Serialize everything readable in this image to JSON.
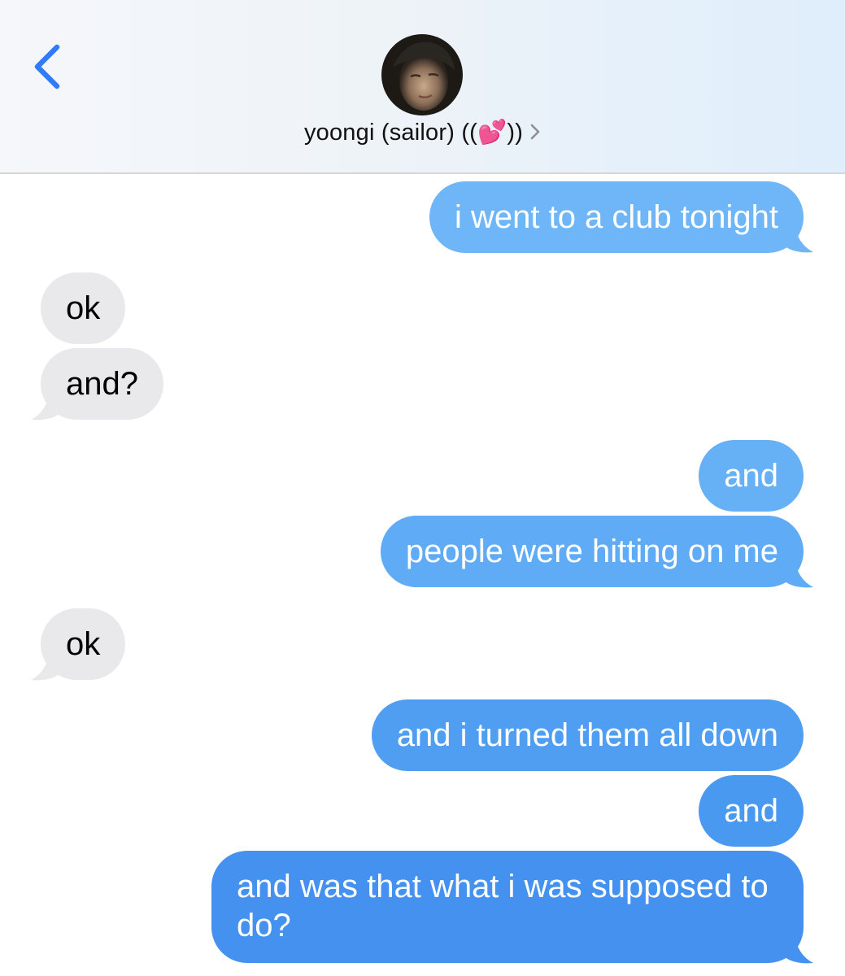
{
  "header": {
    "contact_name": "yoongi (sailor) ((💕))",
    "back_icon": "chevron-left-icon",
    "disclosure_icon": "chevron-right-icon"
  },
  "colors": {
    "sent_top": "#6fb8f7",
    "sent_bottom": "#3a86ee",
    "received": "#e9e9eb",
    "accent": "#2f7cf6"
  },
  "messages": [
    {
      "from": "me",
      "text": "i went to a club tonight"
    },
    {
      "from": "them",
      "text": "ok"
    },
    {
      "from": "them",
      "text": "and?"
    },
    {
      "from": "me",
      "text": "and"
    },
    {
      "from": "me",
      "text": "people were hitting on me"
    },
    {
      "from": "them",
      "text": "ok"
    },
    {
      "from": "me",
      "text": "and i turned them all down"
    },
    {
      "from": "me",
      "text": "and"
    },
    {
      "from": "me",
      "text": "and was that what i was supposed to do?"
    }
  ]
}
